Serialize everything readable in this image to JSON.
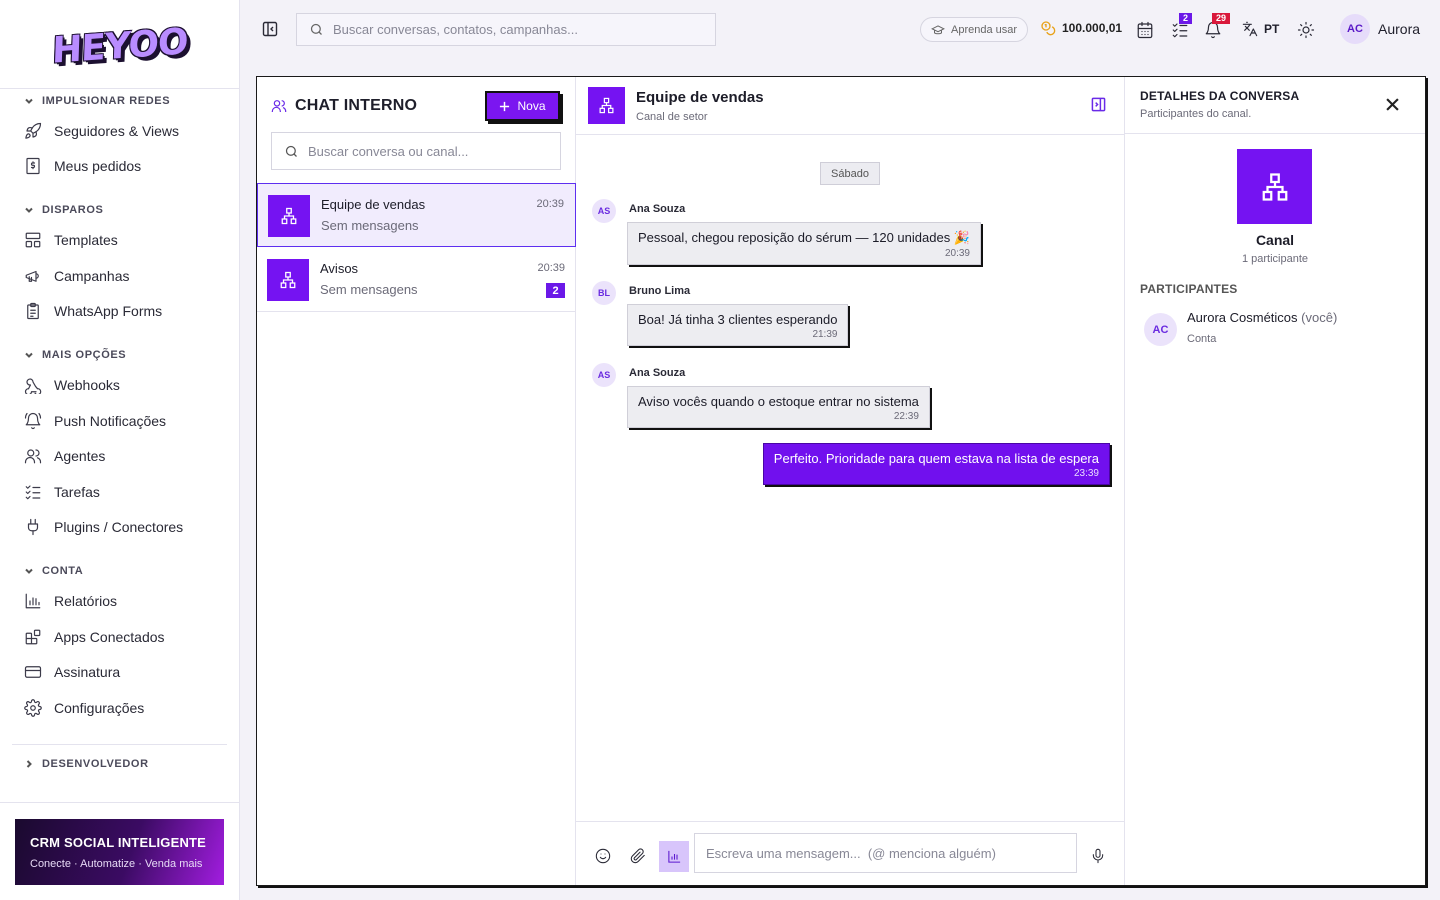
{
  "brand": {
    "logo_text": "HEYOO",
    "accent": "#7513f2"
  },
  "sidebar": {
    "sections": [
      {
        "label": "IMPULSIONAR REDES",
        "items": [
          {
            "label": "Seguidores & Views",
            "icon": "rocket-icon"
          },
          {
            "label": "Meus pedidos",
            "icon": "receipt-icon"
          }
        ]
      },
      {
        "label": "DISPAROS",
        "items": [
          {
            "label": "Templates",
            "icon": "layout-icon"
          },
          {
            "label": "Campanhas",
            "icon": "megaphone-icon"
          },
          {
            "label": "WhatsApp Forms",
            "icon": "clipboard-icon"
          }
        ]
      },
      {
        "label": "MAIS OPÇÕES",
        "items": [
          {
            "label": "Webhooks",
            "icon": "webhook-icon"
          },
          {
            "label": "Push Notificações",
            "icon": "bell-ring-icon"
          },
          {
            "label": "Agentes",
            "icon": "users-icon"
          },
          {
            "label": "Tarefas",
            "icon": "list-checks-icon"
          },
          {
            "label": "Plugins / Conectores",
            "icon": "plug-icon"
          }
        ]
      },
      {
        "label": "CONTA",
        "items": [
          {
            "label": "Relatórios",
            "icon": "bar-chart-icon"
          },
          {
            "label": "Apps Conectados",
            "icon": "blocks-icon"
          },
          {
            "label": "Assinatura",
            "icon": "credit-card-icon"
          },
          {
            "label": "Configurações",
            "icon": "gear-icon"
          }
        ]
      }
    ],
    "developer_label": "DESENVOLVEDOR",
    "promo": {
      "title": "CRM SOCIAL INTELIGENTE",
      "subtitle": "Conecte · Automatize · Venda mais"
    }
  },
  "topbar": {
    "search_placeholder": "Buscar conversas, contatos, campanhas...",
    "learn_label": "Aprenda usar",
    "coins": "100.000,01",
    "tasks_badge": "2",
    "notifications_badge": "29",
    "language": "PT",
    "user_initials": "AC",
    "user_name": "Aurora"
  },
  "chat_list": {
    "title": "CHAT INTERNO",
    "new_button": "Nova",
    "search_placeholder": "Buscar conversa ou canal...",
    "conversations": [
      {
        "name": "Equipe de vendas",
        "preview": "Sem mensagens",
        "time": "20:39",
        "unread": ""
      },
      {
        "name": "Avisos",
        "preview": "Sem mensagens",
        "time": "20:39",
        "unread": "2"
      }
    ]
  },
  "chat": {
    "title": "Equipe de vendas",
    "subtitle": "Canal de setor",
    "day_label": "Sábado",
    "messages": [
      {
        "initials": "AS",
        "author": "Ana Souza",
        "text": "Pessoal, chegou reposição do sérum — 120 unidades 🎉",
        "time": "20:39",
        "mine": false
      },
      {
        "initials": "BL",
        "author": "Bruno Lima",
        "text": "Boa! Já tinha 3 clientes esperando",
        "time": "21:39",
        "mine": false
      },
      {
        "initials": "AS",
        "author": "Ana Souza",
        "text": "Aviso vocês quando o estoque entrar no sistema",
        "time": "22:39",
        "mine": false
      },
      {
        "initials": "",
        "author": "",
        "text": "Perfeito. Prioridade para quem estava na lista de espera",
        "time": "23:39",
        "mine": true
      }
    ],
    "composer_placeholder": "Escreva uma mensagem...  (@ menciona alguém)"
  },
  "details": {
    "title": "DETALHES DA CONVERSA",
    "subtitle": "Participantes do canal.",
    "channel_label": "Canal",
    "participant_count": "1 participante",
    "participants_label": "PARTICIPANTES",
    "participants": [
      {
        "initials": "AC",
        "name": "Aurora Cosméticos",
        "you": "(você)",
        "role": "Conta"
      }
    ]
  }
}
